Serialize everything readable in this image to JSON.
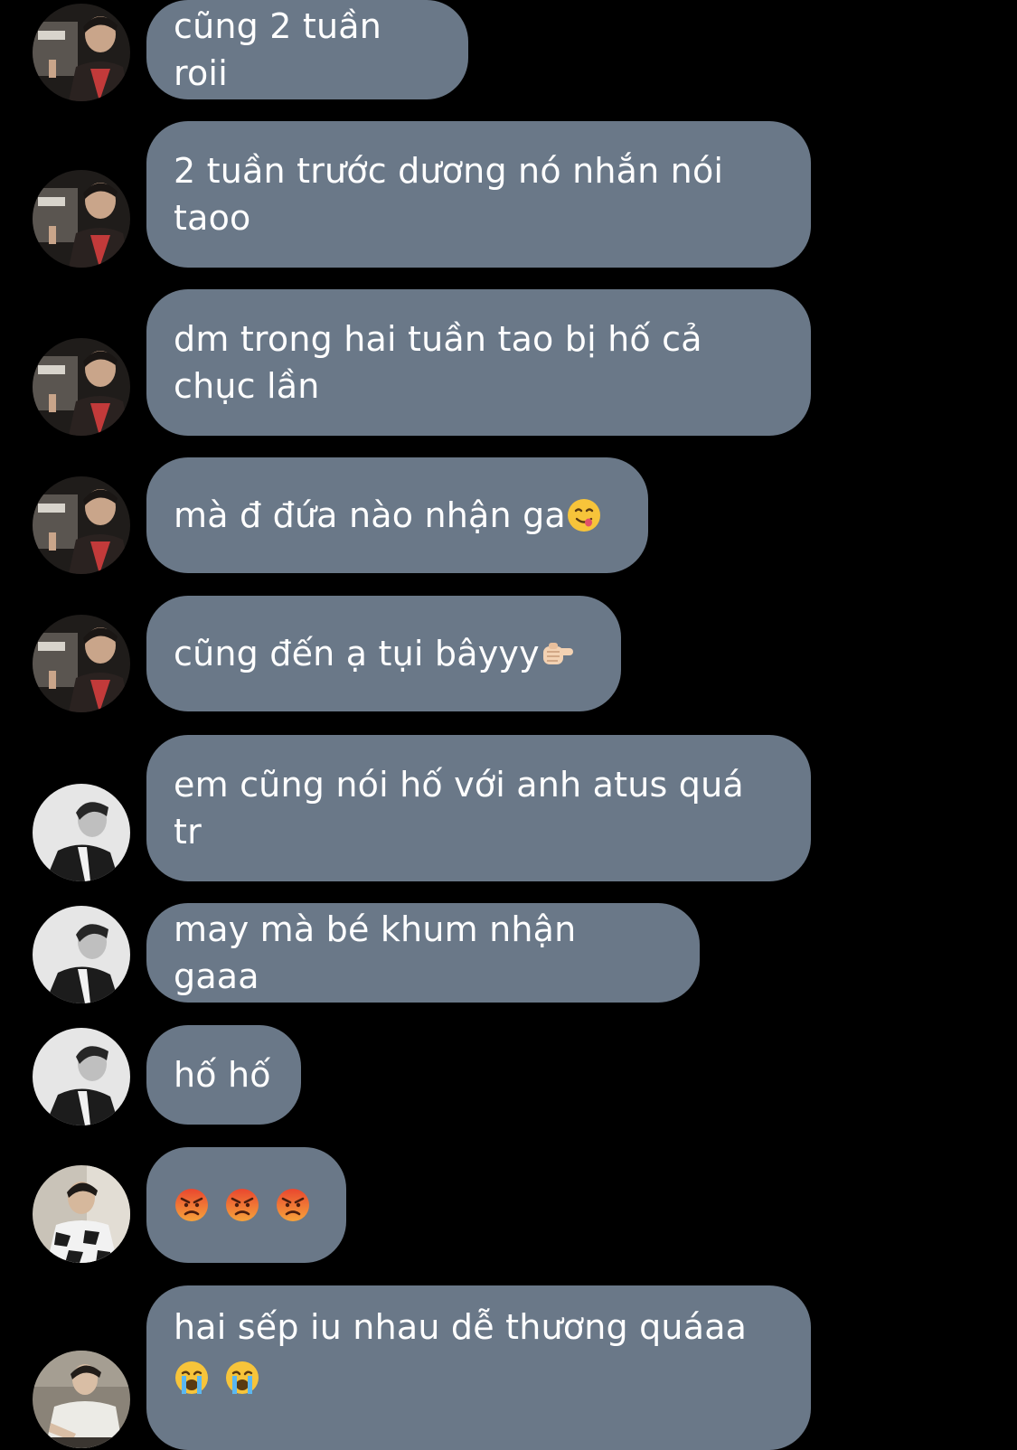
{
  "conversation": {
    "messages": [
      {
        "sender": "A",
        "text": "cũng 2 tuần roii"
      },
      {
        "sender": "A",
        "text": "2 tuần trước dương nó nhắn nói\ntaoo"
      },
      {
        "sender": "A",
        "text": "dm trong hai tuần tao bị hố cả\nchục lần"
      },
      {
        "sender": "A",
        "text": "mà đ đứa nào nhận ga",
        "emoji": "yum-face-emoji"
      },
      {
        "sender": "A",
        "text": "cũng đến ạ tụi bâyyy",
        "emoji": "pointing-fist-emoji"
      },
      {
        "sender": "B",
        "text": "em cũng nói hố với anh atus quá\ntr"
      },
      {
        "sender": "B",
        "text": "may mà bé khum nhận gaaa"
      },
      {
        "sender": "B",
        "text": "hố hố"
      },
      {
        "sender": "C",
        "emojis": [
          "angry-face-emoji",
          "angry-face-emoji",
          "angry-face-emoji"
        ]
      },
      {
        "sender": "D",
        "text": "hai sếp iu nhau dễ thương quáaa",
        "emojis": [
          "crying-face-emoji",
          "crying-face-emoji"
        ]
      }
    ]
  },
  "colors": {
    "background": "#000000",
    "bubble": "#6a7888",
    "text": "#ffffff"
  }
}
